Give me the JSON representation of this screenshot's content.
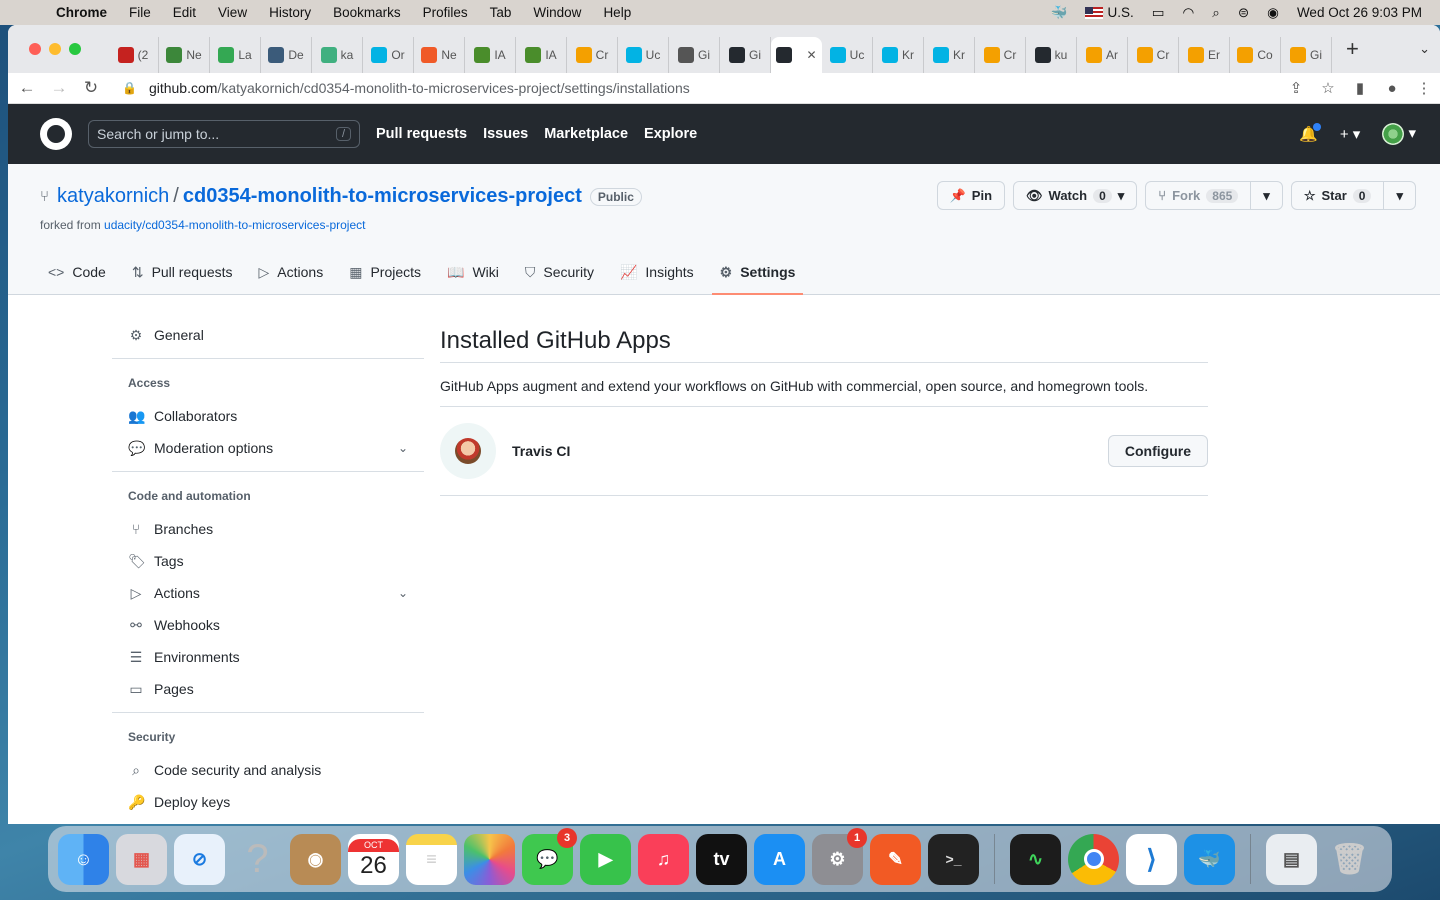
{
  "menubar": {
    "app": "Chrome",
    "items": [
      "File",
      "Edit",
      "View",
      "History",
      "Bookmarks",
      "Profiles",
      "Tab",
      "Window",
      "Help"
    ],
    "input_source": "U.S.",
    "datetime": "Wed Oct 26  9:03 PM"
  },
  "browser": {
    "tabs": [
      {
        "label": "(2",
        "icon": "gmail-icon",
        "color": "#c5221f"
      },
      {
        "label": "Ne",
        "icon": "node-icon",
        "color": "#3c873a"
      },
      {
        "label": "La",
        "icon": "google-icon",
        "color": "#34a853"
      },
      {
        "label": "De",
        "icon": "site-icon",
        "color": "#3b5b7a"
      },
      {
        "label": "ka",
        "icon": "circleci-icon",
        "color": "#40b080"
      },
      {
        "label": "Or",
        "icon": "udacity-icon",
        "color": "#02b3e4"
      },
      {
        "label": "Ne",
        "icon": "aws-icon",
        "color": "#f05a28"
      },
      {
        "label": "IA",
        "icon": "key-icon",
        "color": "#4a8d2b"
      },
      {
        "label": "IA",
        "icon": "key-icon",
        "color": "#4a8d2b"
      },
      {
        "label": "Cr",
        "icon": "aws-box-icon",
        "color": "#f4a000"
      },
      {
        "label": "Uc",
        "icon": "udacity-icon",
        "color": "#02b3e4"
      },
      {
        "label": "Gi",
        "icon": "globe-icon",
        "color": "#555"
      },
      {
        "label": "Gi",
        "icon": "github-icon",
        "color": "#24292f"
      },
      {
        "label": "",
        "icon": "github-icon",
        "color": "#24292f",
        "active": true
      },
      {
        "label": "Uc",
        "icon": "udacity-icon",
        "color": "#02b3e4"
      },
      {
        "label": "Kr",
        "icon": "udacity-icon",
        "color": "#02b3e4"
      },
      {
        "label": "Kr",
        "icon": "udacity-icon",
        "color": "#02b3e4"
      },
      {
        "label": "Cr",
        "icon": "aws-box-icon",
        "color": "#f4a000"
      },
      {
        "label": "ku",
        "icon": "github-icon",
        "color": "#24292f"
      },
      {
        "label": "Ar",
        "icon": "aws-box-icon",
        "color": "#f4a000"
      },
      {
        "label": "Cr",
        "icon": "aws-box-icon",
        "color": "#f4a000"
      },
      {
        "label": "Er",
        "icon": "aws-box-icon",
        "color": "#f4a000"
      },
      {
        "label": "Co",
        "icon": "aws-box-icon",
        "color": "#f4a000"
      },
      {
        "label": "Gi",
        "icon": "aws-box-icon",
        "color": "#f4a000"
      }
    ],
    "url_host": "github.com",
    "url_path": "/katyakornich/cd0354-monolith-to-microservices-project/settings/installations"
  },
  "gh": {
    "search_placeholder": "Search or jump to...",
    "search_key": "/",
    "nav": [
      "Pull requests",
      "Issues",
      "Marketplace",
      "Explore"
    ]
  },
  "repo": {
    "owner": "katyakornich",
    "name": "cd0354-monolith-to-microservices-project",
    "visibility": "Public",
    "forked_prefix": "forked from ",
    "forked_from": "udacity/cd0354-monolith-to-microservices-project",
    "pin": "Pin",
    "watch": "Watch",
    "watch_count": "0",
    "fork": "Fork",
    "fork_count": "865",
    "star": "Star",
    "star_count": "0",
    "tabs": [
      {
        "label": "Code",
        "icon": "code-icon",
        "glyph": "<>"
      },
      {
        "label": "Pull requests",
        "icon": "pull-request-icon",
        "glyph": "⇅"
      },
      {
        "label": "Actions",
        "icon": "play-icon",
        "glyph": "▷"
      },
      {
        "label": "Projects",
        "icon": "table-icon",
        "glyph": "▦"
      },
      {
        "label": "Wiki",
        "icon": "book-icon",
        "glyph": "📖"
      },
      {
        "label": "Security",
        "icon": "shield-icon",
        "glyph": "⛉"
      },
      {
        "label": "Insights",
        "icon": "graph-icon",
        "glyph": "📈"
      },
      {
        "label": "Settings",
        "icon": "gear-icon",
        "glyph": "⚙",
        "selected": true
      }
    ]
  },
  "sidebar": {
    "general": "General",
    "access_heading": "Access",
    "collaborators": "Collaborators",
    "moderation": "Moderation options",
    "code_heading": "Code and automation",
    "branches": "Branches",
    "tags": "Tags",
    "actions": "Actions",
    "webhooks": "Webhooks",
    "environments": "Environments",
    "pages": "Pages",
    "security_heading": "Security",
    "code_security": "Code security and analysis",
    "deploy_keys": "Deploy keys"
  },
  "main": {
    "title": "Installed GitHub Apps",
    "description": "GitHub Apps augment and extend your workflows on GitHub with commercial, open source, and homegrown tools.",
    "app_name": "Travis CI",
    "configure": "Configure"
  },
  "dock": {
    "messages_badge": "3",
    "settings_badge": "1",
    "calendar_month": "OCT",
    "calendar_day": "26"
  }
}
